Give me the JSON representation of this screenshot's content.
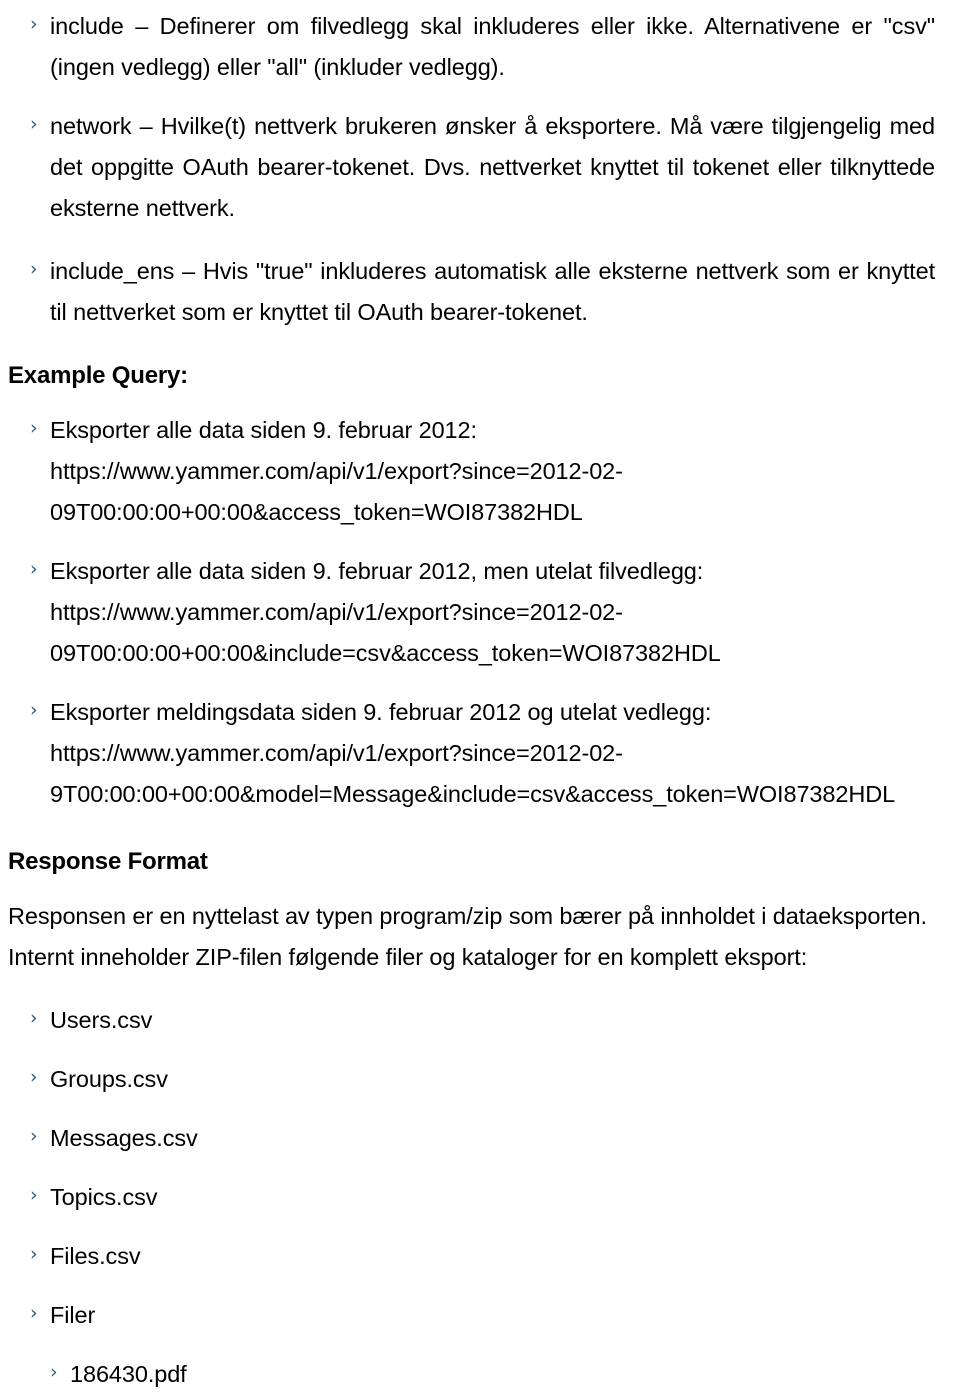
{
  "page": {
    "background_color": "#ffffff",
    "text_color": "#000000",
    "bullet_color": "#2e5f7d",
    "bullet_glyph": "›"
  },
  "params": [
    {
      "id": "include",
      "lines": [
        "include – Definerer om filvedlegg skal inkluderes eller ikke. Alternativene er \"csv\"",
        "(ingen vedlegg) eller \"all\" (inkluder vedlegg)."
      ],
      "text": "include – Definerer om filvedlegg skal inkluderes eller ikke. Alternativene er \"csv\" (ingen vedlegg) eller \"all\" (inkluder vedlegg)."
    },
    {
      "id": "network",
      "lines": [
        "network – Hvilke(t) nettverk brukeren ønsker å eksportere. Må være tilgjengelig med",
        "det oppgitte OAuth bearer-tokenet. Dvs. nettverket knyttet til tokenet eller tilknyttede",
        "eksterne nettverk."
      ],
      "text": "network – Hvilke(t) nettverk brukeren ønsker å eksportere. Må være tilgjengelig med det oppgitte OAuth bearer-tokenet. Dvs. nettverket knyttet til tokenet eller tilknyttede eksterne nettverk."
    },
    {
      "id": "include_ens",
      "lines": [
        "include_ens – Hvis \"true\" inkluderes automatisk alle eksterne nettverk som er knyttet til",
        "nettverket som er knyttet til OAuth bearer-tokenet."
      ],
      "text": "include_ens – Hvis \"true\" inkluderes automatisk alle eksterne nettverk som er knyttet til nettverket som er knyttet til OAuth bearer-tokenet."
    }
  ],
  "example_query": {
    "heading": "Example Query:",
    "items": [
      {
        "caption": "Eksporter alle data siden 9. februar 2012:",
        "url_lines": [
          "https://www.yammer.com/api/v1/export?since=2012-02-",
          "09T00:00:00+00:00&access_token=WOI87382HDL"
        ],
        "url": "https://www.yammer.com/api/v1/export?since=2012-02-09T00:00:00+00:00&access_token=WOI87382HDL"
      },
      {
        "caption": "Eksporter alle data siden 9. februar 2012, men utelat filvedlegg:",
        "url_lines": [
          "https://www.yammer.com/api/v1/export?since=2012-02-",
          "09T00:00:00+00:00&include=csv&access_token=WOI87382HDL"
        ],
        "url": "https://www.yammer.com/api/v1/export?since=2012-02-09T00:00:00+00:00&include=csv&access_token=WOI87382HDL"
      },
      {
        "caption": "Eksporter meldingsdata siden 9. februar 2012 og utelat vedlegg:",
        "url_lines": [
          "https://www.yammer.com/api/v1/export?since=2012-02-",
          "9T00:00:00+00:00&model=Message&include=csv&access_token=WOI87382HDL"
        ],
        "url": "https://www.yammer.com/api/v1/export?since=2012-02-9T00:00:00+00:00&model=Message&include=csv&access_token=WOI87382HDL"
      }
    ]
  },
  "response_format": {
    "heading": "Response Format",
    "paragraph_lines": [
      "Responsen er en nyttelast av typen program/zip som bærer på innholdet i dataeksporten.",
      "Internt inneholder ZIP-filen følgende filer og kataloger for en komplett eksport:"
    ],
    "paragraph": "Responsen er en nyttelast av typen program/zip som bærer på innholdet i dataeksporten. Internt inneholder ZIP-filen følgende filer og kataloger for en komplett eksport:",
    "files": [
      {
        "name": "Users.csv",
        "level": 1
      },
      {
        "name": "Groups.csv",
        "level": 1
      },
      {
        "name": "Messages.csv",
        "level": 1
      },
      {
        "name": "Topics.csv",
        "level": 1
      },
      {
        "name": "Files.csv",
        "level": 1
      },
      {
        "name": "Filer",
        "level": 1
      },
      {
        "name": "186430.pdf",
        "level": 2
      }
    ]
  }
}
